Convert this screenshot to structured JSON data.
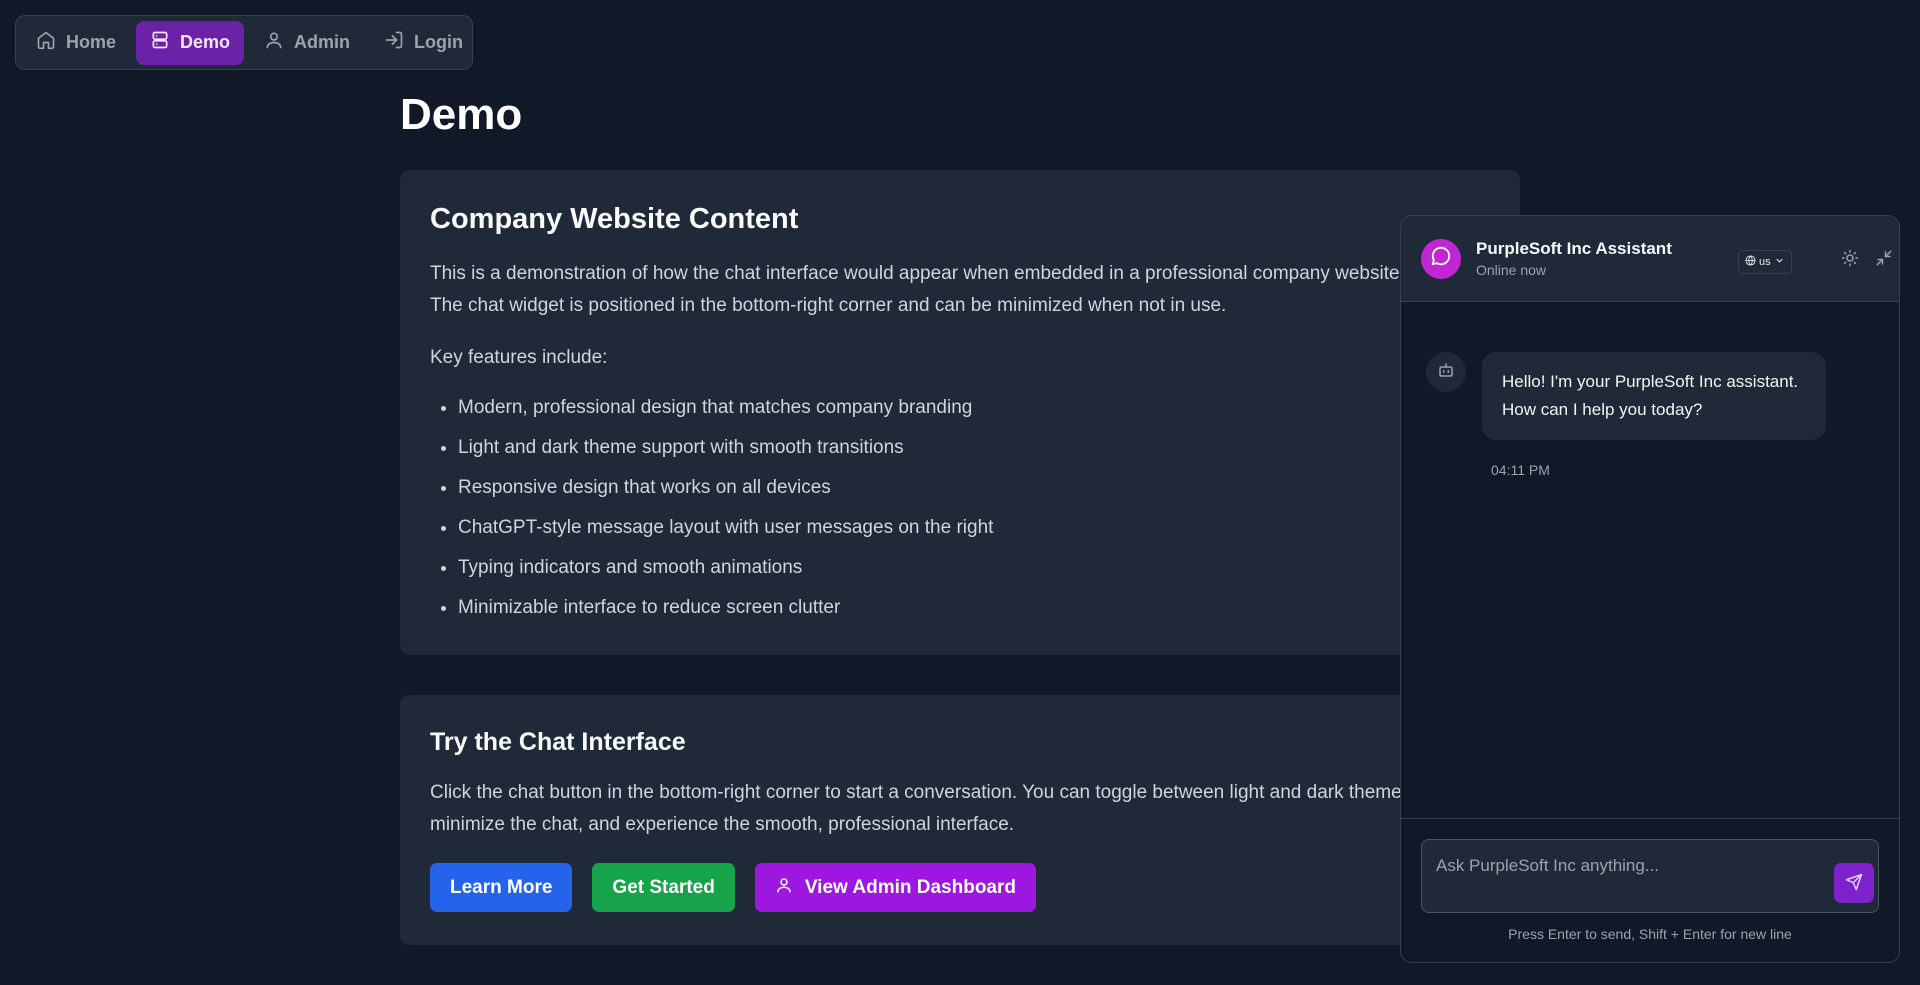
{
  "nav": {
    "items": [
      {
        "label": "Home",
        "icon": "home-icon",
        "active": false
      },
      {
        "label": "Demo",
        "icon": "demo-icon",
        "active": true
      },
      {
        "label": "Admin",
        "icon": "user-icon",
        "active": false
      },
      {
        "label": "Login",
        "icon": "login-icon",
        "active": false
      }
    ]
  },
  "page": {
    "title": "Demo"
  },
  "content_card": {
    "heading": "Company Website Content",
    "intro_line1": "This is a demonstration of how the chat interface would appear when embedded in a professional company website.",
    "intro_line2": "The chat widget is positioned in the bottom-right corner and can be minimized when not in use.",
    "features_label": "Key features include:",
    "features": [
      "Modern, professional design that matches company branding",
      "Light and dark theme support with smooth transitions",
      "Responsive design that works on all devices",
      "ChatGPT-style message layout with user messages on the right",
      "Typing indicators and smooth animations",
      "Minimizable interface to reduce screen clutter"
    ]
  },
  "try_card": {
    "heading": "Try the Chat Interface",
    "desc_line1": "Click the chat button in the bottom-right corner to start a conversation. You can toggle between light and dark themes,",
    "desc_line2": "minimize the chat, and experience the smooth, professional interface.",
    "buttons": {
      "learn_more": "Learn More",
      "get_started": "Get Started",
      "admin_dashboard": "View Admin Dashboard"
    }
  },
  "chat": {
    "name": "PurpleSoft Inc Assistant",
    "status": "Online now",
    "language": "us",
    "messages": [
      {
        "sender": "bot",
        "text": "Hello! I'm your PurpleSoft Inc assistant. How can I help you today?",
        "time": "04:11 PM"
      }
    ],
    "input_placeholder": "Ask PurpleSoft Inc anything...",
    "hint": "Press Enter to send, Shift + Enter for new line"
  },
  "colors": {
    "background": "#111827",
    "card": "#1f2937",
    "accent_purple": "#9d17e0",
    "nav_active": "#6b21a8",
    "button_blue": "#2563eb",
    "button_green": "#16a34a",
    "avatar": "#c026d3"
  }
}
